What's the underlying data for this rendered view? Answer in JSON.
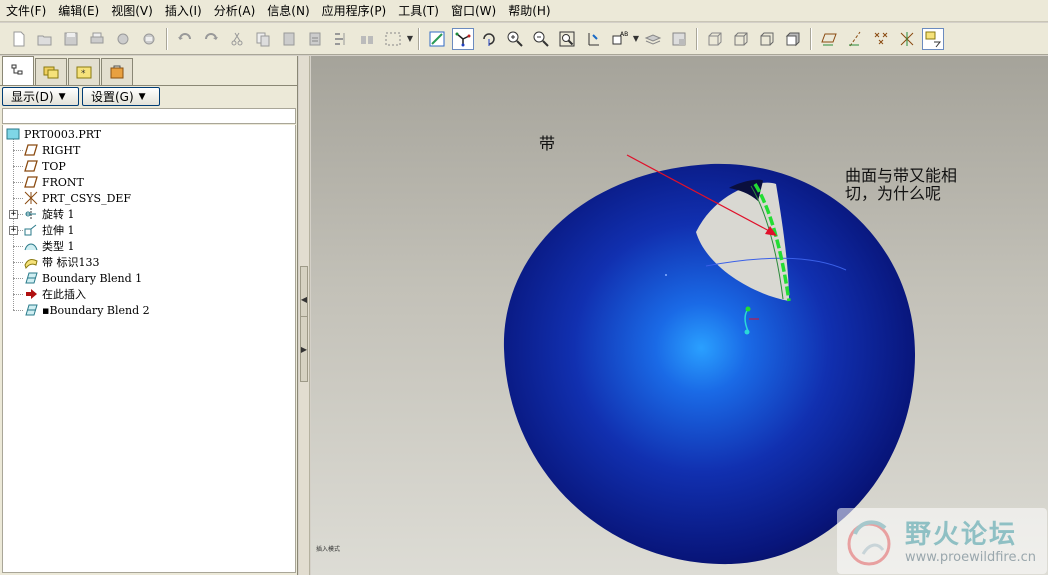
{
  "menubar": {
    "items": [
      "文件(F)",
      "编辑(E)",
      "视图(V)",
      "插入(I)",
      "分析(A)",
      "信息(N)",
      "应用程序(P)",
      "工具(T)",
      "窗口(W)",
      "帮助(H)"
    ]
  },
  "toolbar": {
    "icons": [
      "new-icon",
      "open-icon",
      "save-icon",
      "print-icon",
      "send-icon",
      "mail-icon",
      "undo-icon",
      "redo-icon",
      "cut-icon",
      "copy-icon",
      "paste-icon",
      "paste-special-icon",
      "regenerate-icon",
      "binoculars-icon",
      "select-box-icon",
      "repaint-icon",
      "spin-center-icon",
      "orient-icon",
      "zoom-in-icon",
      "zoom-out-icon",
      "refit-icon",
      "reorient-icon",
      "view-manager-icon",
      "layers-icon",
      "view-list-icon",
      "wireframe-icon",
      "hidden-line-icon",
      "no-hidden-icon",
      "shaded-icon",
      "datum-plane-icon",
      "datum-axis-icon",
      "datum-point-icon",
      "csys-icon",
      "annotation-icon"
    ]
  },
  "panel": {
    "tabs": [
      "model-tree-tab",
      "folder-tab",
      "favorites-tab",
      "tools-tab"
    ],
    "show_button": "显示(D)",
    "settings_button": "设置(G)"
  },
  "tree": {
    "root": "PRT0003.PRT",
    "nodes": [
      {
        "label": "RIGHT",
        "icon": "datum-plane-icon"
      },
      {
        "label": "TOP",
        "icon": "datum-plane-icon"
      },
      {
        "label": "FRONT",
        "icon": "datum-plane-icon"
      },
      {
        "label": "PRT_CSYS_DEF",
        "icon": "csys-icon"
      },
      {
        "label": "旋转 1",
        "icon": "revolve-icon"
      },
      {
        "label": "拉伸 1",
        "icon": "extrude-icon"
      },
      {
        "label": "类型 1",
        "icon": "surface-icon"
      },
      {
        "label": "带 标识133",
        "icon": "band-icon"
      },
      {
        "label": "Boundary Blend 1",
        "icon": "boundary-blend-icon"
      },
      {
        "label": "在此插入",
        "icon": "insert-here-icon"
      },
      {
        "label": "▪Boundary Blend 2",
        "icon": "boundary-blend-icon"
      }
    ]
  },
  "viewport": {
    "annotation_band": "带",
    "annotation_question_line1": "曲面与带又能相",
    "annotation_question_line2": "切，为什么呢",
    "status_text": "插入模式"
  },
  "watermark": {
    "title": "野火论坛",
    "url": "www.proewildfire.cn"
  },
  "colors": {
    "sphere": "#1a2fb0",
    "band_curve": "#22dd33",
    "arrow": "#e0102a",
    "accent": "#316ac5"
  }
}
